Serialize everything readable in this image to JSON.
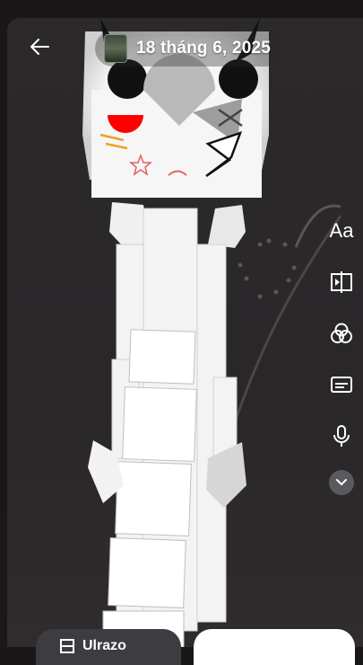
{
  "header": {
    "back_icon": "arrow-left-icon",
    "date_label": "18 tháng 6, 2025",
    "thumbnail_icon": "photo-thumbnail"
  },
  "tools": [
    {
      "name": "text-tool",
      "label": "Aa",
      "icon": "text-icon"
    },
    {
      "name": "split-tool",
      "icon": "split-view-icon"
    },
    {
      "name": "filter-tool",
      "icon": "filter-circles-icon"
    },
    {
      "name": "caption-tool",
      "icon": "caption-icon"
    },
    {
      "name": "voice-tool",
      "icon": "microphone-icon"
    },
    {
      "name": "more-tool",
      "icon": "chevron-down-icon"
    }
  ],
  "bottom": {
    "left_label": "Ulrazo",
    "left_icon": "grid-icon"
  },
  "colors": {
    "background": "#1a1719",
    "canvas": "#2c292b",
    "accent_red": "#ff0000",
    "accent_orange": "#f0a020"
  }
}
